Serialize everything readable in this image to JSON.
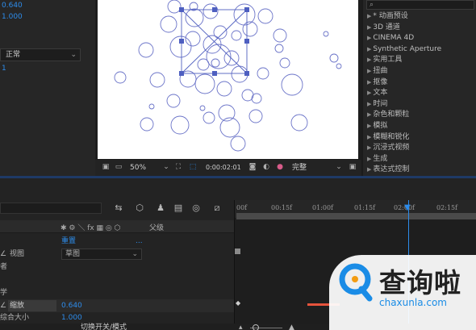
{
  "left_panel": {
    "value_top": "0.640",
    "value_second": "1.000",
    "mode_select": "正常",
    "value_small": "1"
  },
  "viewer": {
    "zoom": "50%",
    "timecode": "0:00:02:01",
    "resolution": "完整"
  },
  "effects_panel": {
    "items": [
      "* 动画预设",
      "3D 通道",
      "CINEMA 4D",
      "Synthetic Aperture",
      "实用工具",
      "扭曲",
      "抠像",
      "文本",
      "时间",
      "杂色和颗粒",
      "模拟",
      "模糊和锐化",
      "沉浸式视频",
      "生成",
      "表达式控制"
    ]
  },
  "timeline": {
    "ruler_labels": [
      "00f",
      "00:15f",
      "01:00f",
      "01:15f",
      "02:00f",
      "02:15f"
    ],
    "header_parent": "父级",
    "row_reset": "重置",
    "row_view": "视图",
    "row_view_select": "草图",
    "row_text_a": "者",
    "row_text_b": "学",
    "row_scale_label": "缩放",
    "row_scale_value": "0.640",
    "row_composite_label": "综合大小",
    "row_composite_value": "1.000",
    "footer_toggle": "切换开关/模式"
  },
  "watermark": {
    "brand": "查询啦",
    "url": "chaxunla.com"
  },
  "colors": {
    "accent_blue": "#2d8ceb",
    "panel_bg": "#232323",
    "watermark_blue": "#1a8ce6",
    "keyframe_bar": "#e5533c"
  }
}
